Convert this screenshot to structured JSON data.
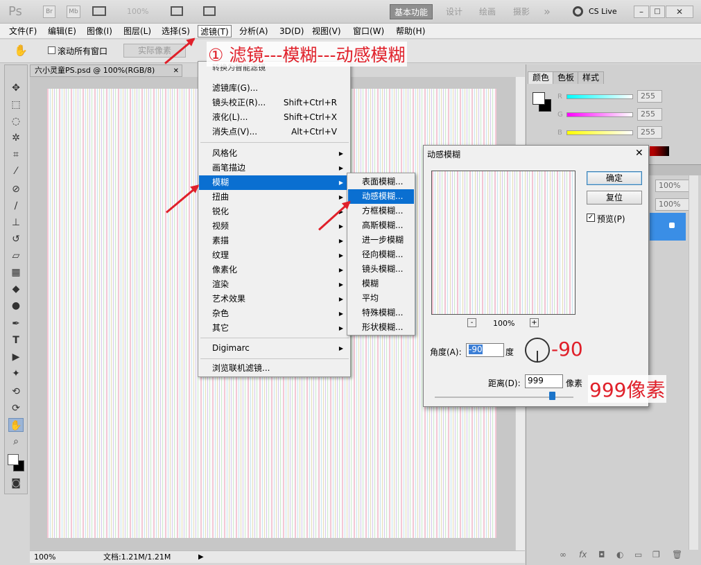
{
  "titlebar": {
    "logo": "Ps",
    "br": "Br",
    "mb": "Mb",
    "zoom": "100%",
    "workspaces": [
      "基本功能",
      "设计",
      "绘画",
      "摄影"
    ],
    "more": "»",
    "cslive": "CS Live"
  },
  "menubar": {
    "items": [
      "文件(F)",
      "编辑(E)",
      "图像(I)",
      "图层(L)",
      "选择(S)",
      "滤镜(T)",
      "分析(A)",
      "3D(D)",
      "视图(V)",
      "窗口(W)",
      "帮助(H)"
    ]
  },
  "options": {
    "scroll_all": "滚动所有窗口",
    "actual_pixels": "实际像素"
  },
  "document": {
    "tab_title": "六小灵童PS.psd @ 100%(RGB/8)",
    "status_zoom": "100%",
    "status_doc": "文档:1.21M/1.21M"
  },
  "filter_menu": {
    "top_item": "转换为智能滤镜",
    "shortcut_top": "F",
    "items": [
      {
        "label": "滤镜库(G)...",
        "shortcut": ""
      },
      {
        "label": "镜头校正(R)...",
        "shortcut": "Shift+Ctrl+R"
      },
      {
        "label": "液化(L)...",
        "shortcut": "Shift+Ctrl+X"
      },
      {
        "label": "消失点(V)...",
        "shortcut": "Alt+Ctrl+V"
      }
    ],
    "categories": [
      "风格化",
      "画笔描边",
      "模糊",
      "扭曲",
      "锐化",
      "视频",
      "素描",
      "纹理",
      "像素化",
      "渲染",
      "艺术效果",
      "杂色",
      "其它"
    ],
    "digimarc": "Digimarc",
    "browse": "浏览联机滤镜..."
  },
  "blur_submenu": {
    "items": [
      "表面模糊...",
      "动感模糊...",
      "方框模糊...",
      "高斯模糊...",
      "进一步模糊",
      "径向模糊...",
      "镜头模糊...",
      "模糊",
      "平均",
      "特殊模糊...",
      "形状模糊..."
    ]
  },
  "dialog": {
    "title": "动感模糊",
    "ok": "确定",
    "reset": "复位",
    "preview_label": "预览(P)",
    "preview_zoom": "100%",
    "minus": "-",
    "plus": "+",
    "angle_label": "角度(A):",
    "angle_value": "-90",
    "angle_unit": "度",
    "distance_label": "距离(D):",
    "distance_value": "999",
    "distance_unit": "像素"
  },
  "panels": {
    "tabs": [
      "颜色",
      "色板",
      "样式"
    ],
    "channels": [
      {
        "name": "R",
        "value": "255"
      },
      {
        "name": "G",
        "value": "255"
      },
      {
        "name": "B",
        "value": "255"
      }
    ],
    "opacity": "100%",
    "fill": "100%"
  },
  "annotations": {
    "step": "① 滤镜---模糊---动感模糊",
    "angle": "-90",
    "distance": "999像素"
  }
}
